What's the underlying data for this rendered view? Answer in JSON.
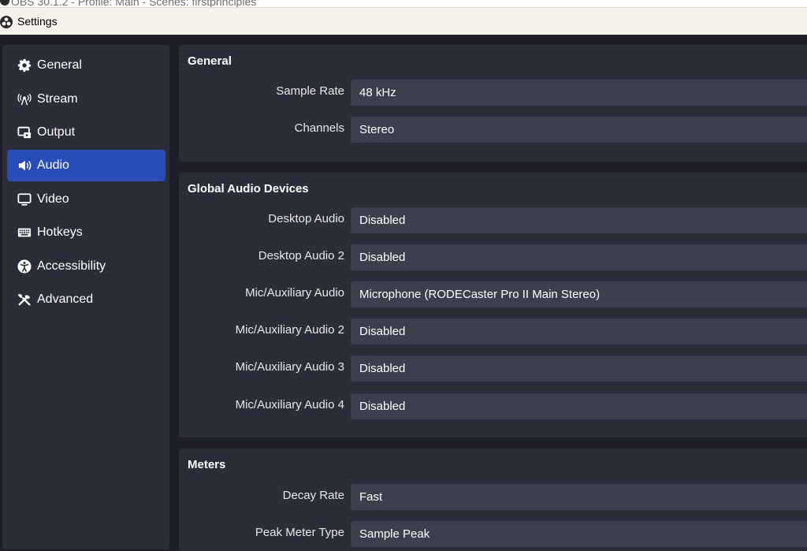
{
  "background_window": {
    "title": "OBS 30.1.2 - Profile: Main - Scenes: firstprinciples"
  },
  "window": {
    "title": "Settings"
  },
  "sidebar": {
    "items": [
      {
        "label": "General",
        "icon": "gear-icon"
      },
      {
        "label": "Stream",
        "icon": "antenna-icon"
      },
      {
        "label": "Output",
        "icon": "output-icon"
      },
      {
        "label": "Audio",
        "icon": "speaker-icon",
        "active": true
      },
      {
        "label": "Video",
        "icon": "monitor-icon"
      },
      {
        "label": "Hotkeys",
        "icon": "keyboard-icon"
      },
      {
        "label": "Accessibility",
        "icon": "accessibility-icon"
      },
      {
        "label": "Advanced",
        "icon": "wrench-icon"
      }
    ]
  },
  "general": {
    "title": "General",
    "sample_rate_label": "Sample Rate",
    "sample_rate_value": "48 kHz",
    "channels_label": "Channels",
    "channels_value": "Stereo"
  },
  "devices": {
    "title": "Global Audio Devices",
    "rows": [
      {
        "label": "Desktop Audio",
        "value": "Disabled"
      },
      {
        "label": "Desktop Audio 2",
        "value": "Disabled"
      },
      {
        "label": "Mic/Auxiliary Audio",
        "value": "Microphone (RODECaster Pro II Main Stereo)"
      },
      {
        "label": "Mic/Auxiliary Audio 2",
        "value": "Disabled"
      },
      {
        "label": "Mic/Auxiliary Audio 3",
        "value": "Disabled"
      },
      {
        "label": "Mic/Auxiliary Audio 4",
        "value": "Disabled"
      }
    ]
  },
  "meters": {
    "title": "Meters",
    "decay_rate_label": "Decay Rate",
    "decay_rate_value": "Fast",
    "peak_meter_type_label": "Peak Meter Type",
    "peak_meter_type_value": "Sample Peak"
  },
  "colors": {
    "window_bg": "#1e1f29",
    "panel_bg": "#2b2e38",
    "field_bg": "#3c404d",
    "accent": "#284cb8"
  }
}
